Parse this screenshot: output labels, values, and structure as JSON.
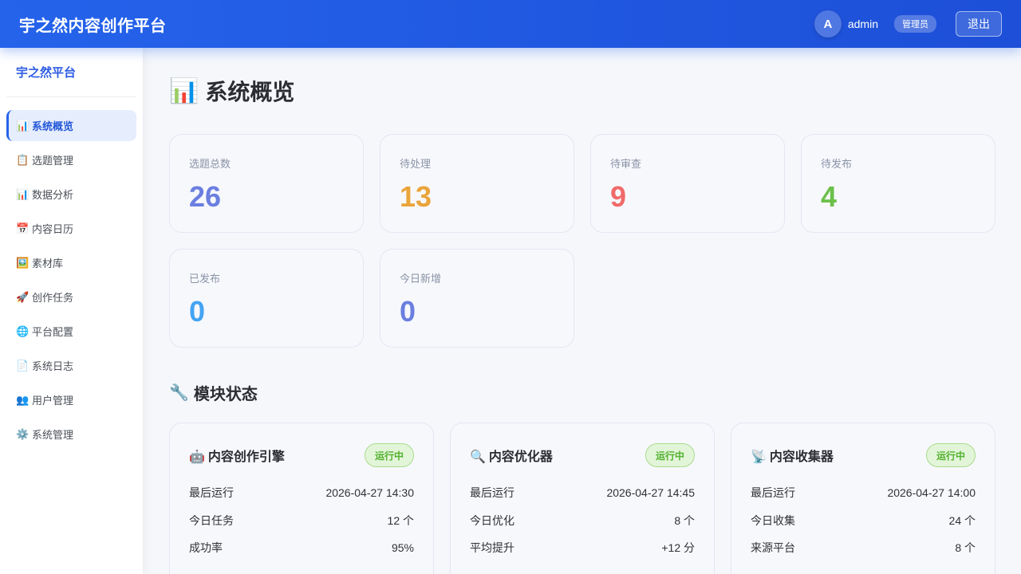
{
  "header": {
    "brand": "宇之然内容创作平台",
    "avatar_letter": "A",
    "username": "admin",
    "role": "管理员",
    "logout_label": "退出"
  },
  "sidebar": {
    "title": "宇之然平台",
    "items": [
      {
        "icon": "📊",
        "label": "系统概览",
        "active": true
      },
      {
        "icon": "📋",
        "label": "选题管理"
      },
      {
        "icon": "📊",
        "label": "数据分析"
      },
      {
        "icon": "📅",
        "label": "内容日历"
      },
      {
        "icon": "🖼️",
        "label": "素材库"
      },
      {
        "icon": "🚀",
        "label": "创作任务"
      },
      {
        "icon": "🌐",
        "label": "平台配置"
      },
      {
        "icon": "📄",
        "label": "系统日志"
      },
      {
        "icon": "👥",
        "label": "用户管理"
      },
      {
        "icon": "⚙️",
        "label": "系统管理"
      }
    ]
  },
  "page": {
    "title_icon": "📊",
    "title": "系统概览"
  },
  "stats": [
    {
      "label": "选题总数",
      "value": "26",
      "color": "#6b7fe0"
    },
    {
      "label": "待处理",
      "value": "13",
      "color": "#eaa43a"
    },
    {
      "label": "待审查",
      "value": "9",
      "color": "#f06a6a"
    },
    {
      "label": "待发布",
      "value": "4",
      "color": "#6cc04a"
    },
    {
      "label": "已发布",
      "value": "0",
      "color": "#44a4f2"
    },
    {
      "label": "今日新增",
      "value": "0",
      "color": "#6b7fe0"
    }
  ],
  "modules_section": {
    "icon": "🔧",
    "title": "模块状态"
  },
  "modules": [
    {
      "icon": "🤖",
      "name": "内容创作引擎",
      "status": "运行中",
      "rows": [
        {
          "label": "最后运行",
          "value": "2026-04-27 14:30"
        },
        {
          "label": "今日任务",
          "value": "12 个"
        },
        {
          "label": "成功率",
          "value": "95%"
        }
      ]
    },
    {
      "icon": "🔍",
      "name": "内容优化器",
      "status": "运行中",
      "rows": [
        {
          "label": "最后运行",
          "value": "2026-04-27 14:45"
        },
        {
          "label": "今日优化",
          "value": "8 个"
        },
        {
          "label": "平均提升",
          "value": "+12 分"
        }
      ]
    },
    {
      "icon": "📡",
      "name": "内容收集器",
      "status": "运行中",
      "rows": [
        {
          "label": "最后运行",
          "value": "2026-04-27 14:00"
        },
        {
          "label": "今日收集",
          "value": "24 个"
        },
        {
          "label": "来源平台",
          "value": "8 个"
        }
      ]
    }
  ]
}
